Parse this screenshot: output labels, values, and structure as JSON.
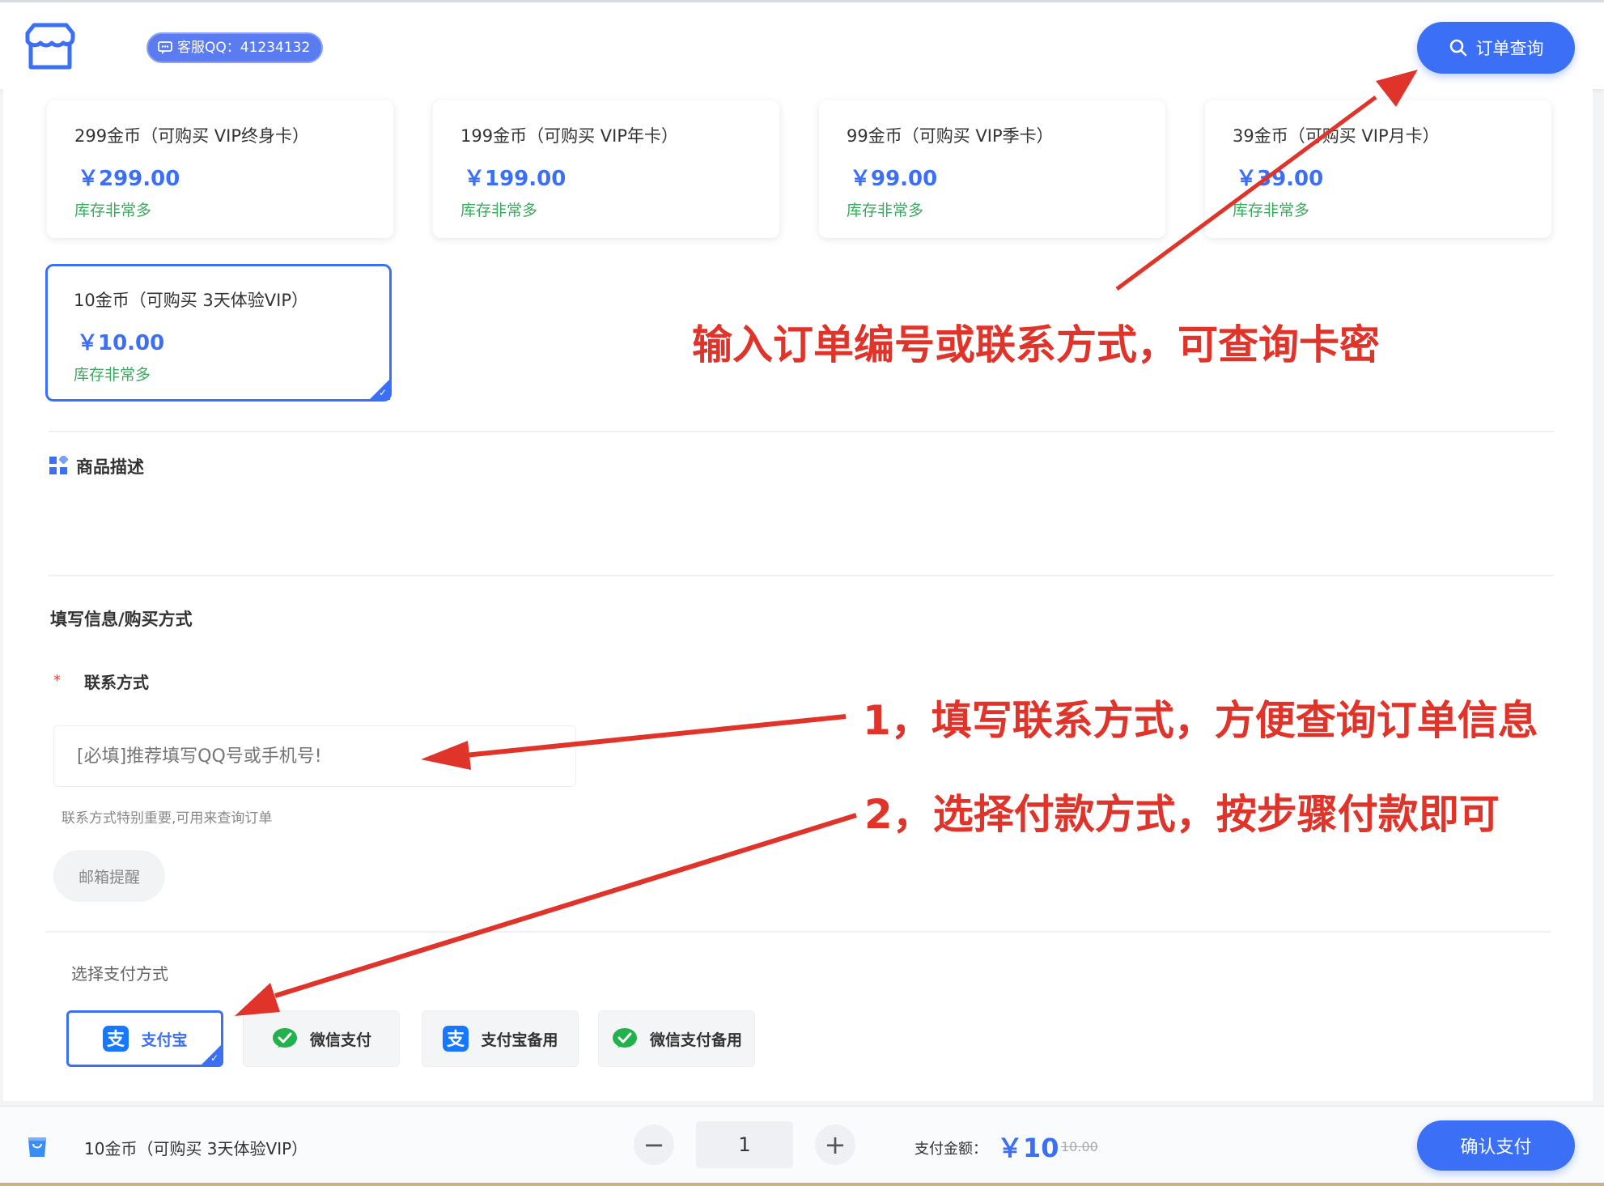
{
  "header": {
    "qq_badge": "客服QQ：41234132",
    "order_query_label": "订单查询"
  },
  "products": [
    {
      "name": "299金币（可购买 VIP终身卡）",
      "price": "￥299.00",
      "stock": "库存非常多",
      "selected": false
    },
    {
      "name": "199金币（可购买 VIP年卡）",
      "price": "￥199.00",
      "stock": "库存非常多",
      "selected": false
    },
    {
      "name": "99金币（可购买 VIP季卡）",
      "price": "￥99.00",
      "stock": "库存非常多",
      "selected": false
    },
    {
      "name": "39金币（可购买 VIP月卡）",
      "price": "￥39.00",
      "stock": "库存非常多",
      "selected": false
    },
    {
      "name": "10金币（可购买 3天体验VIP）",
      "price": "￥10.00",
      "stock": "库存非常多",
      "selected": true
    }
  ],
  "description": {
    "title": "商品描述"
  },
  "form": {
    "section_title": "填写信息/购买方式",
    "contact_label": "联系方式",
    "required_mark": "*",
    "contact_placeholder": "[必填]推荐填写QQ号或手机号!",
    "contact_value": "",
    "hint": "联系方式特别重要,可用来查询订单",
    "email_reminder_label": "邮箱提醒",
    "pay_method_label": "选择支付方式",
    "pay_methods": [
      {
        "label": "支付宝",
        "icon": "alipay-icon",
        "selected": true
      },
      {
        "label": "微信支付",
        "icon": "wechat-pay-icon",
        "selected": false
      },
      {
        "label": "支付宝备用",
        "icon": "alipay-icon",
        "selected": false
      },
      {
        "label": "微信支付备用",
        "icon": "wechat-pay-icon",
        "selected": false
      }
    ]
  },
  "bottom_bar": {
    "selected_product": "10金币（可购买 3天体验VIP）",
    "quantity": "1",
    "minus": "−",
    "plus": "+",
    "pay_amount_label": "支付金额：",
    "pay_amount": "￥10",
    "original_amount": "10.00",
    "confirm_label": "确认支付"
  },
  "annotations": {
    "top": "输入订单编号或联系方式，可查询卡密",
    "step1": "1，填写联系方式，方便查询订单信息",
    "step2": "2，选择付款方式，按步骤付款即可"
  },
  "colors": {
    "accent": "#3b6ff5",
    "stock": "#3aaa5e",
    "annotation": "#e0332a"
  }
}
